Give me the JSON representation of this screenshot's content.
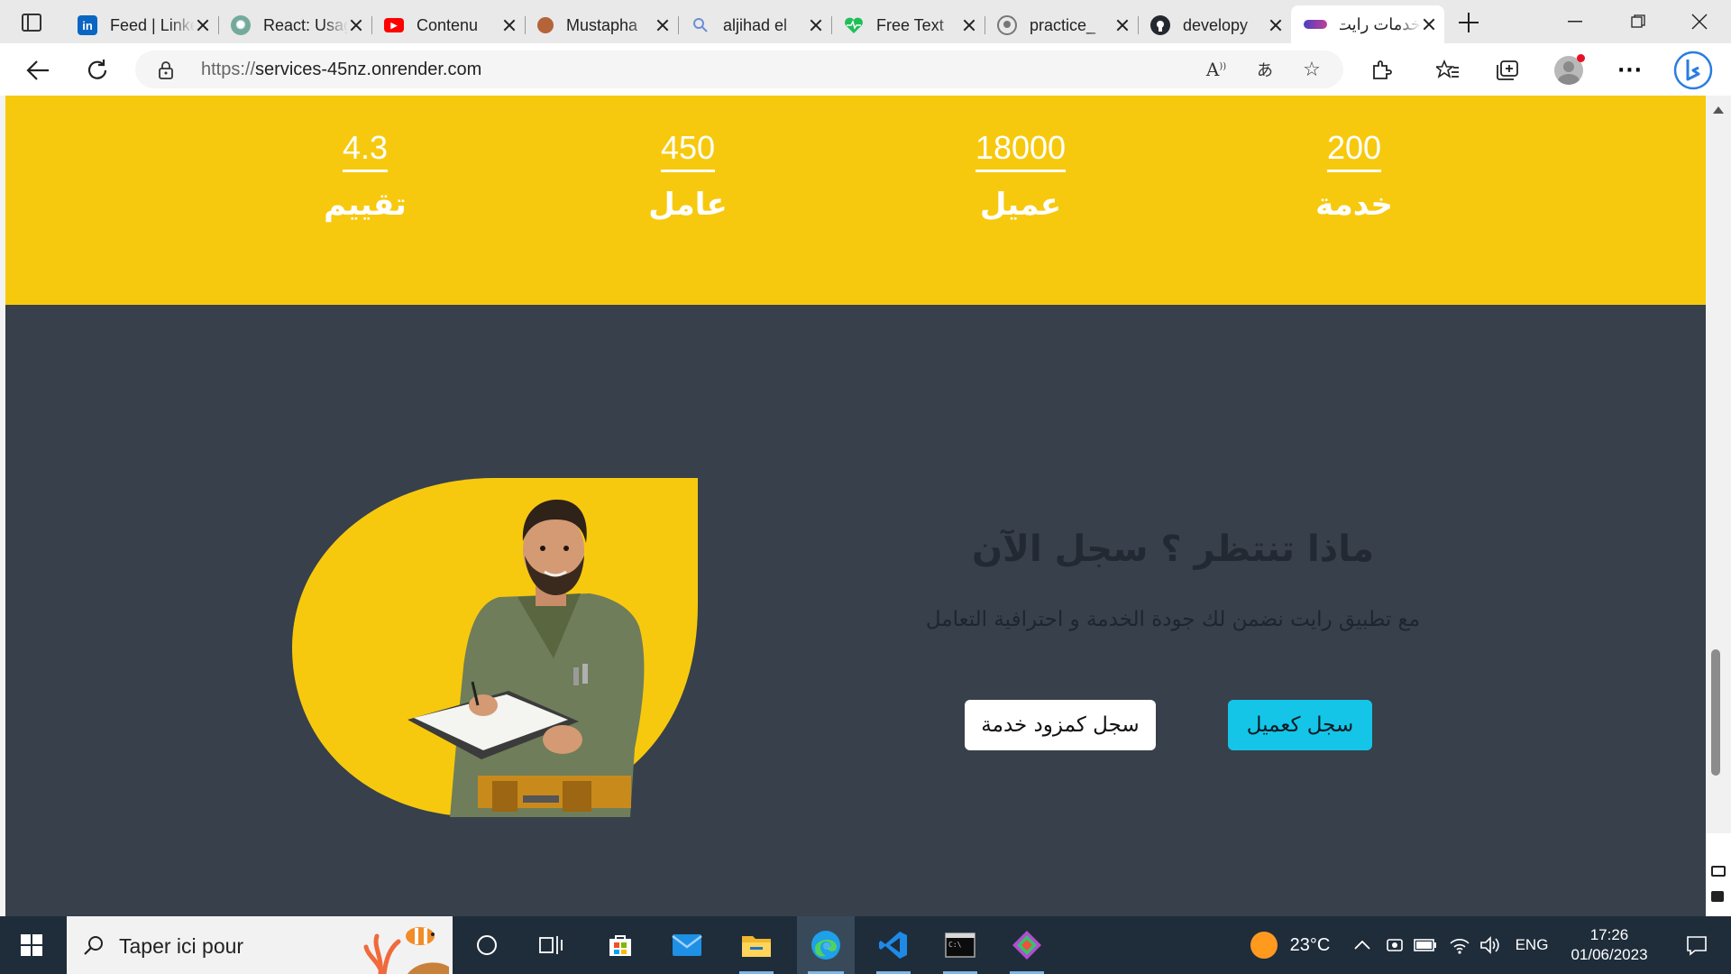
{
  "browser": {
    "tabs": [
      {
        "title": "Feed | LinkedIn",
        "icon": "linkedin-icon",
        "color": "#0a66c2"
      },
      {
        "title": "React: Usage",
        "icon": "chatgpt-icon",
        "color": "#74aa9c"
      },
      {
        "title": "Contenu",
        "icon": "youtube-icon",
        "color": "#ff0000"
      },
      {
        "title": "Mustapha",
        "icon": "avatar-icon",
        "color": "#b5643a"
      },
      {
        "title": "aljihad el",
        "icon": "search-icon",
        "color": "#6b8fd6"
      },
      {
        "title": "Free Text",
        "icon": "heart-icon",
        "color": "#1fbf58"
      },
      {
        "title": "practice_",
        "icon": "github-icon",
        "color": "#24292f"
      },
      {
        "title": "developy",
        "icon": "github-icon",
        "color": "#24292f"
      },
      {
        "title": "خدمات رايت",
        "icon": "site-logo-icon",
        "color": "#4b3fc0",
        "active": true
      }
    ],
    "url_scheme": "https://",
    "url_host": "services-45nz.onrender.com"
  },
  "page": {
    "stats": [
      {
        "value": "200",
        "label": "خدمة"
      },
      {
        "value": "18000",
        "label": "عميل"
      },
      {
        "value": "450",
        "label": "عامل"
      },
      {
        "value": "4.3",
        "label": "تقييم"
      }
    ],
    "cta": {
      "title": "ماذا تنتظر ؟ سجل الآن",
      "subtitle": "مع تطبيق رايت نضمن لك جودة الخدمة و احترافية التعامل",
      "client_button": "سجل كعميل",
      "provider_button": "سجل كمزود خدمة"
    },
    "colors": {
      "yellow": "#f7c90e",
      "dark": "#37404b",
      "cyan": "#14c5e8"
    }
  },
  "taskbar": {
    "search_placeholder": "Taper ici pour",
    "weather": "23°C",
    "language": "ENG",
    "time": "17:26",
    "date": "01/06/2023"
  }
}
